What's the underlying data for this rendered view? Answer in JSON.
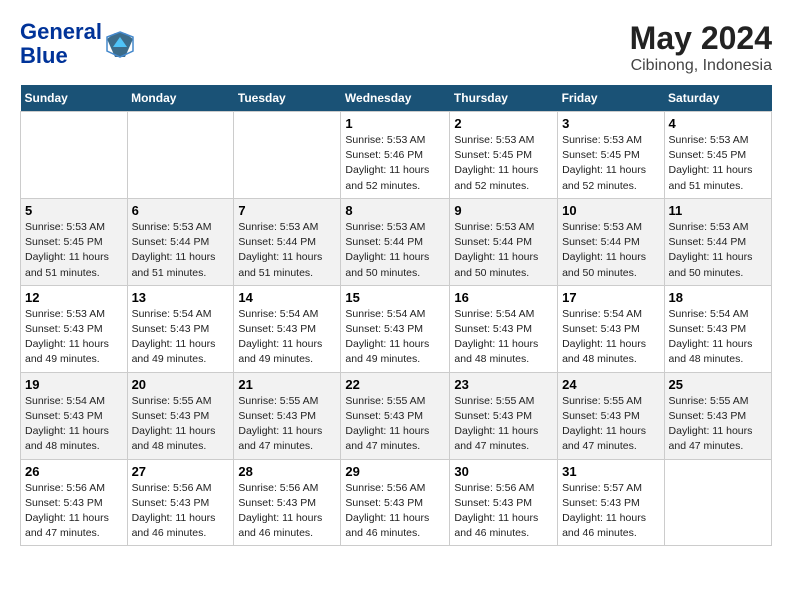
{
  "logo": {
    "line1": "General",
    "line2": "Blue"
  },
  "title": "May 2024",
  "subtitle": "Cibinong, Indonesia",
  "days_header": [
    "Sunday",
    "Monday",
    "Tuesday",
    "Wednesday",
    "Thursday",
    "Friday",
    "Saturday"
  ],
  "weeks": [
    [
      {
        "day": "",
        "info": ""
      },
      {
        "day": "",
        "info": ""
      },
      {
        "day": "",
        "info": ""
      },
      {
        "day": "1",
        "info": "Sunrise: 5:53 AM\nSunset: 5:46 PM\nDaylight: 11 hours\nand 52 minutes."
      },
      {
        "day": "2",
        "info": "Sunrise: 5:53 AM\nSunset: 5:45 PM\nDaylight: 11 hours\nand 52 minutes."
      },
      {
        "day": "3",
        "info": "Sunrise: 5:53 AM\nSunset: 5:45 PM\nDaylight: 11 hours\nand 52 minutes."
      },
      {
        "day": "4",
        "info": "Sunrise: 5:53 AM\nSunset: 5:45 PM\nDaylight: 11 hours\nand 51 minutes."
      }
    ],
    [
      {
        "day": "5",
        "info": "Sunrise: 5:53 AM\nSunset: 5:45 PM\nDaylight: 11 hours\nand 51 minutes."
      },
      {
        "day": "6",
        "info": "Sunrise: 5:53 AM\nSunset: 5:44 PM\nDaylight: 11 hours\nand 51 minutes."
      },
      {
        "day": "7",
        "info": "Sunrise: 5:53 AM\nSunset: 5:44 PM\nDaylight: 11 hours\nand 51 minutes."
      },
      {
        "day": "8",
        "info": "Sunrise: 5:53 AM\nSunset: 5:44 PM\nDaylight: 11 hours\nand 50 minutes."
      },
      {
        "day": "9",
        "info": "Sunrise: 5:53 AM\nSunset: 5:44 PM\nDaylight: 11 hours\nand 50 minutes."
      },
      {
        "day": "10",
        "info": "Sunrise: 5:53 AM\nSunset: 5:44 PM\nDaylight: 11 hours\nand 50 minutes."
      },
      {
        "day": "11",
        "info": "Sunrise: 5:53 AM\nSunset: 5:44 PM\nDaylight: 11 hours\nand 50 minutes."
      }
    ],
    [
      {
        "day": "12",
        "info": "Sunrise: 5:53 AM\nSunset: 5:43 PM\nDaylight: 11 hours\nand 49 minutes."
      },
      {
        "day": "13",
        "info": "Sunrise: 5:54 AM\nSunset: 5:43 PM\nDaylight: 11 hours\nand 49 minutes."
      },
      {
        "day": "14",
        "info": "Sunrise: 5:54 AM\nSunset: 5:43 PM\nDaylight: 11 hours\nand 49 minutes."
      },
      {
        "day": "15",
        "info": "Sunrise: 5:54 AM\nSunset: 5:43 PM\nDaylight: 11 hours\nand 49 minutes."
      },
      {
        "day": "16",
        "info": "Sunrise: 5:54 AM\nSunset: 5:43 PM\nDaylight: 11 hours\nand 48 minutes."
      },
      {
        "day": "17",
        "info": "Sunrise: 5:54 AM\nSunset: 5:43 PM\nDaylight: 11 hours\nand 48 minutes."
      },
      {
        "day": "18",
        "info": "Sunrise: 5:54 AM\nSunset: 5:43 PM\nDaylight: 11 hours\nand 48 minutes."
      }
    ],
    [
      {
        "day": "19",
        "info": "Sunrise: 5:54 AM\nSunset: 5:43 PM\nDaylight: 11 hours\nand 48 minutes."
      },
      {
        "day": "20",
        "info": "Sunrise: 5:55 AM\nSunset: 5:43 PM\nDaylight: 11 hours\nand 48 minutes."
      },
      {
        "day": "21",
        "info": "Sunrise: 5:55 AM\nSunset: 5:43 PM\nDaylight: 11 hours\nand 47 minutes."
      },
      {
        "day": "22",
        "info": "Sunrise: 5:55 AM\nSunset: 5:43 PM\nDaylight: 11 hours\nand 47 minutes."
      },
      {
        "day": "23",
        "info": "Sunrise: 5:55 AM\nSunset: 5:43 PM\nDaylight: 11 hours\nand 47 minutes."
      },
      {
        "day": "24",
        "info": "Sunrise: 5:55 AM\nSunset: 5:43 PM\nDaylight: 11 hours\nand 47 minutes."
      },
      {
        "day": "25",
        "info": "Sunrise: 5:55 AM\nSunset: 5:43 PM\nDaylight: 11 hours\nand 47 minutes."
      }
    ],
    [
      {
        "day": "26",
        "info": "Sunrise: 5:56 AM\nSunset: 5:43 PM\nDaylight: 11 hours\nand 47 minutes."
      },
      {
        "day": "27",
        "info": "Sunrise: 5:56 AM\nSunset: 5:43 PM\nDaylight: 11 hours\nand 46 minutes."
      },
      {
        "day": "28",
        "info": "Sunrise: 5:56 AM\nSunset: 5:43 PM\nDaylight: 11 hours\nand 46 minutes."
      },
      {
        "day": "29",
        "info": "Sunrise: 5:56 AM\nSunset: 5:43 PM\nDaylight: 11 hours\nand 46 minutes."
      },
      {
        "day": "30",
        "info": "Sunrise: 5:56 AM\nSunset: 5:43 PM\nDaylight: 11 hours\nand 46 minutes."
      },
      {
        "day": "31",
        "info": "Sunrise: 5:57 AM\nSunset: 5:43 PM\nDaylight: 11 hours\nand 46 minutes."
      },
      {
        "day": "",
        "info": ""
      }
    ]
  ]
}
